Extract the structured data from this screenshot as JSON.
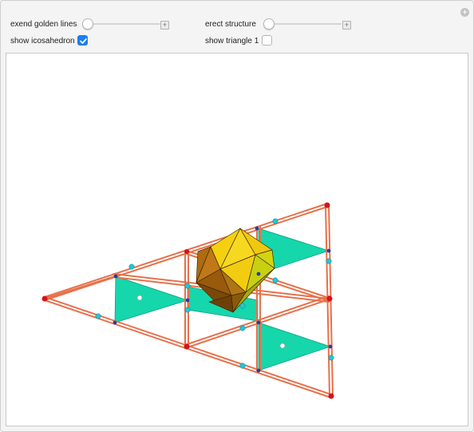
{
  "controls": {
    "golden_lines": {
      "label": "exend golden lines",
      "value": 0
    },
    "erect_structure": {
      "label": "erect structure",
      "value": 0
    },
    "show_icosahedron": {
      "label": "show icosahedron",
      "checked": true
    },
    "show_triangle_1": {
      "label": "show triangle 1",
      "checked": false
    }
  },
  "icons": {
    "corner": "plus-circle-icon",
    "slider_plus": "plus-square-icon",
    "checkmark": "checkmark-icon"
  },
  "colors": {
    "frame": "#e8704a",
    "red_node": "#d4141a",
    "cyan_node": "#1ec8d8",
    "blue_node": "#2140a6",
    "teal_face": "#16d6ac",
    "icosa_yellow": "#f2cf10",
    "icosa_brown": "#a06010",
    "icosa_lime": "#c8d010"
  }
}
